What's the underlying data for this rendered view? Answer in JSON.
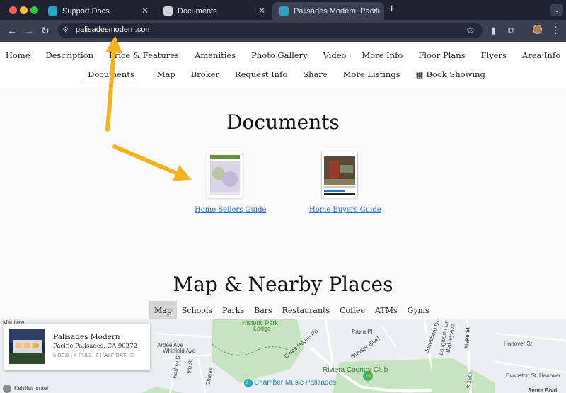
{
  "browser": {
    "tabs": [
      {
        "title": "Support Docs",
        "favicon_color": "#2aa7c7"
      },
      {
        "title": "Documents",
        "favicon_color": "#d0d2da"
      },
      {
        "title": "Palisades Modern, Pacific Palis",
        "favicon_color": "#2aa7c7"
      }
    ],
    "url": "palisadesmodern.com",
    "icons": {
      "back": "back-arrow-icon",
      "forward": "forward-arrow-icon",
      "reload": "reload-icon",
      "site_info": "site-settings-icon",
      "bookmark": "star-icon",
      "extensions": "puzzle-icon",
      "menu": "more-vertical-icon"
    }
  },
  "nav": {
    "row1": [
      "Home",
      "Description",
      "Price & Features",
      "Amenities",
      "Photo Gallery",
      "Video",
      "More Info",
      "Floor Plans",
      "Flyers",
      "Area Info"
    ],
    "row2": [
      "Documents",
      "Map",
      "Broker",
      "Request Info",
      "Share",
      "More Listings",
      "Book Showing"
    ]
  },
  "documents": {
    "title": "Documents",
    "items": [
      {
        "label": "Home Sellers Guide"
      },
      {
        "label": "Home Buyers Guide"
      }
    ]
  },
  "map_section": {
    "title": "Map & Nearby Places",
    "tabs": [
      "Map",
      "Schools",
      "Parks",
      "Bars",
      "Restaurants",
      "Coffee",
      "ATMs",
      "Gyms"
    ],
    "active_tab": "Map",
    "labels": {
      "matthew": "Matthew",
      "historic_park": "Historic Park",
      "lodge": "Lodge",
      "gates_house": "Gates House Rd",
      "pavia": "Pavia Pl",
      "jonesboro": "Jonesboro Dr",
      "longworth": "Longworth Dr",
      "binkley": "Binkley Ave",
      "fiske": "Fiske St",
      "hanover": "Hanover St",
      "sunset": "Sunset Blvd",
      "riviera": "Riviera Country Club",
      "chamber": "Chamber Music Palisades",
      "kehillat": "Kehillat Israel",
      "evanston": "Evanston St",
      "sente": "Sente Blvd",
      "whitfield": "Whitfield Ave",
      "ardee": "Ardee Ave",
      "harlow": "Harlow St",
      "ninth": "9th St",
      "charlotte": "Charlot",
      "twentysixth": "S 26th",
      "hanover2": "Hanover"
    }
  },
  "listing": {
    "name": "Palisades Modern",
    "address": "Pacific Palisades, CA 90272",
    "specs": "5 BED | 4 FULL, 2 HALF BATHS"
  },
  "colors": {
    "link": "#2d6fd6",
    "annotation_arrow": "#f6b21c",
    "map_green": "#b9dfb4",
    "chrome_dark": "#1f2230",
    "chrome_toolbar": "#3b3f52"
  }
}
